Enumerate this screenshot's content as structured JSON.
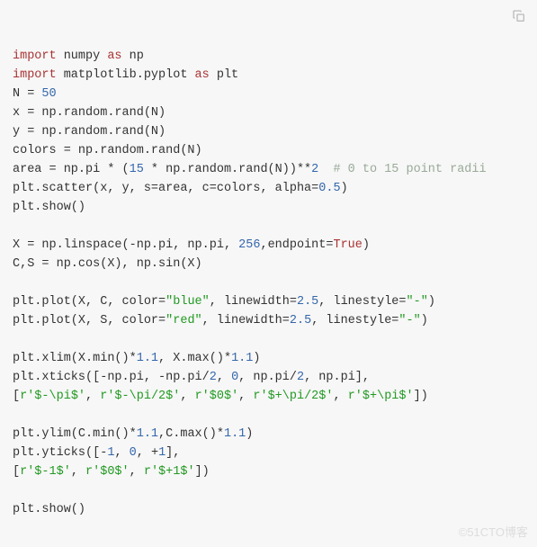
{
  "watermark": "©51CTO博客",
  "code": {
    "l1_import": "import",
    "l1_numpy": " numpy ",
    "l1_as": "as",
    "l1_np": " np",
    "l2_import": "import",
    "l2_mpl": " matplotlib.pyplot ",
    "l2_as": "as",
    "l2_plt": " plt",
    "l3a": "N = ",
    "l3n": "50",
    "l4": "x = np.random.rand(N)",
    "l5": "y = np.random.rand(N)",
    "l6": "colors = np.random.rand(N)",
    "l7a": "area = np.pi * (",
    "l7n1": "15",
    "l7b": " * np.random.rand(N))**",
    "l7n2": "2",
    "l7c": "  # 0 to 15 point radii",
    "l8a": "plt.scatter(x, y, s=area, c=colors, alpha=",
    "l8n": "0.5",
    "l8b": ")",
    "l9": "plt.show()",
    "l11a": "X = np.linspace(-np.pi, np.pi, ",
    "l11n": "256",
    "l11b": ",endpoint=",
    "l11t": "True",
    "l11c": ")",
    "l12": "C,S = np.cos(X), np.sin(X)",
    "l14a": "plt.plot(X, C, color=",
    "l14s": "\"blue\"",
    "l14b": ", linewidth=",
    "l14n": "2.5",
    "l14c": ", linestyle=",
    "l14s2": "\"-\"",
    "l14d": ")",
    "l15a": "plt.plot(X, S, color=",
    "l15s": "\"red\"",
    "l15b": ", linewidth=",
    "l15n": "2.5",
    "l15c": ", linestyle=",
    "l15s2": "\"-\"",
    "l15d": ")",
    "l17a": "plt.xlim(X.min()*",
    "l17n1": "1.1",
    "l17b": ", X.max()*",
    "l17n2": "1.1",
    "l17c": ")",
    "l18a": "plt.xticks([-np.pi, -np.pi/",
    "l18n1": "2",
    "l18b": ", ",
    "l18n2": "0",
    "l18c": ", np.pi/",
    "l18n3": "2",
    "l18d": ", np.pi],",
    "l19a": "[",
    "l19s1": "r'$-\\pi$'",
    "l19b": ", ",
    "l19s2": "r'$-\\pi/2$'",
    "l19c": ", ",
    "l19s3": "r'$0$'",
    "l19d": ", ",
    "l19s4": "r'$+\\pi/2$'",
    "l19e": ", ",
    "l19s5": "r'$+\\pi$'",
    "l19f": "])",
    "l21a": "plt.ylim(C.min()*",
    "l21n1": "1.1",
    "l21b": ",C.max()*",
    "l21n2": "1.1",
    "l21c": ")",
    "l22a": "plt.yticks([-",
    "l22n1": "1",
    "l22b": ", ",
    "l22n2": "0",
    "l22c": ", +",
    "l22n3": "1",
    "l22d": "],",
    "l23a": "[",
    "l23s1": "r'$-1$'",
    "l23b": ", ",
    "l23s2": "r'$0$'",
    "l23c": ", ",
    "l23s3": "r'$+1$'",
    "l23d": "])",
    "l25": "plt.show()"
  }
}
